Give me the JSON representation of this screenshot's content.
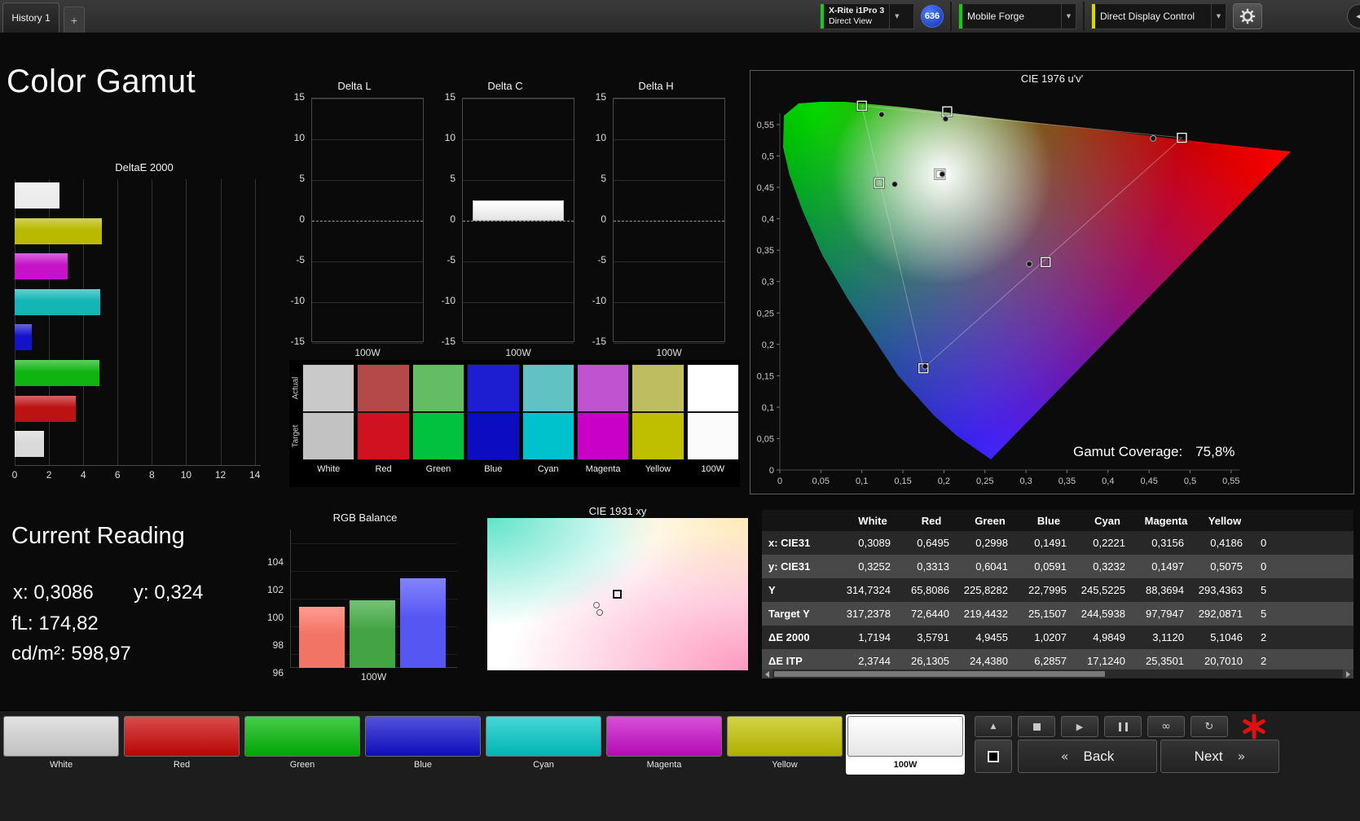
{
  "top_bar": {
    "history_tab": "History 1",
    "add_tab": "+",
    "meter": {
      "line1": "X-Rite i1Pro 3",
      "line2": "Direct View",
      "badge": "636"
    },
    "source": "Mobile Forge",
    "display_control": "Direct Display Control"
  },
  "page_title": "Color Gamut",
  "current_reading": {
    "title": "Current Reading",
    "x_label": "x:",
    "x_value": "0,3086",
    "y_label": "y:",
    "y_value": "0,324",
    "fl_label": "fL:",
    "fl_value": "174,82",
    "cd_label": "cd/m²:",
    "cd_value": "598,97"
  },
  "gamut_coverage": {
    "label": "Gamut Coverage:",
    "value": "75,8%"
  },
  "swatch_strip": {
    "row_labels": [
      "Actual",
      "Target"
    ],
    "columns": [
      {
        "label": "White",
        "actual": "#c9c9c9",
        "target": "#c2c2c2"
      },
      {
        "label": "Red",
        "actual": "#b54848",
        "target": "#d01120"
      },
      {
        "label": "Green",
        "actual": "#64bd64",
        "target": "#00c23e"
      },
      {
        "label": "Blue",
        "actual": "#1d1dd2",
        "target": "#0c0cc2"
      },
      {
        "label": "Cyan",
        "actual": "#60c2c2",
        "target": "#00c2cc"
      },
      {
        "label": "Magenta",
        "actual": "#c053cf",
        "target": "#c800c8"
      },
      {
        "label": "Yellow",
        "actual": "#bebe60",
        "target": "#bfbf00"
      },
      {
        "label": "100W",
        "actual": "#ffffff",
        "target": "#fbfbfb"
      }
    ]
  },
  "table": {
    "columns": [
      "",
      "White",
      "Red",
      "Green",
      "Blue",
      "Cyan",
      "Magenta",
      "Yellow"
    ],
    "rows": [
      {
        "label": "x: CIE31",
        "values": [
          "0,3089",
          "0,6495",
          "0,2998",
          "0,1491",
          "0,2221",
          "0,3156",
          "0,4186"
        ],
        "clipped": "0"
      },
      {
        "label": "y: CIE31",
        "values": [
          "0,3252",
          "0,3313",
          "0,6041",
          "0,0591",
          "0,3232",
          "0,1497",
          "0,5075"
        ],
        "clipped": "0"
      },
      {
        "label": "Y",
        "values": [
          "314,7324",
          "65,8086",
          "225,8282",
          "22,7995",
          "245,5225",
          "88,3694",
          "293,4363"
        ],
        "clipped": "5"
      },
      {
        "label": "Target Y",
        "values": [
          "317,2378",
          "72,6440",
          "219,4432",
          "25,1507",
          "244,5938",
          "97,7947",
          "292,0871"
        ],
        "clipped": "5"
      },
      {
        "label": "ΔE 2000",
        "values": [
          "1,7194",
          "3,5791",
          "4,9455",
          "1,0207",
          "4,9849",
          "3,1120",
          "5,1046"
        ],
        "clipped": "2"
      },
      {
        "label": "ΔE ITP",
        "values": [
          "2,3744",
          "26,1305",
          "24,4380",
          "6,2857",
          "17,1240",
          "25,3501",
          "20,7010"
        ],
        "clipped": "2"
      }
    ]
  },
  "chart_data": [
    {
      "id": "deltae2000",
      "type": "bar",
      "orientation": "horizontal",
      "title": "DeltaE 2000",
      "categories": [
        "100W",
        "Yellow",
        "Magenta",
        "Cyan",
        "Blue",
        "Green",
        "Red",
        "White"
      ],
      "values": [
        2.6,
        5.1,
        3.11,
        4.98,
        1.02,
        4.95,
        3.58,
        1.72
      ],
      "bar_colors": [
        "#ececec",
        "#b9b900",
        "#c713c7",
        "#13b5b5",
        "#1313cc",
        "#10b410",
        "#bc1212",
        "#d9d9d9"
      ],
      "xticks": [
        0,
        2,
        4,
        6,
        8,
        10,
        12,
        14
      ],
      "xlim": [
        0,
        14.35
      ],
      "grid": "vertical"
    },
    {
      "id": "delta_l",
      "type": "bar",
      "title": "Delta L",
      "categories": [
        "100W"
      ],
      "values": [
        0
      ],
      "yticks": [
        15,
        10,
        5,
        0,
        -5,
        -10,
        -15
      ],
      "ylim": [
        -15,
        15
      ],
      "xlabel": "100W"
    },
    {
      "id": "delta_c",
      "type": "bar",
      "title": "Delta C",
      "categories": [
        "100W"
      ],
      "values": [
        2.5
      ],
      "yticks": [
        15,
        10,
        5,
        0,
        -5,
        -10,
        -15
      ],
      "ylim": [
        -15,
        15
      ],
      "xlabel": "100W"
    },
    {
      "id": "delta_h",
      "type": "bar",
      "title": "Delta H",
      "categories": [
        "100W"
      ],
      "values": [
        0
      ],
      "yticks": [
        15,
        10,
        5,
        0,
        -5,
        -10,
        -15
      ],
      "ylim": [
        -15,
        15
      ],
      "xlabel": "100W"
    },
    {
      "id": "cie1976",
      "type": "scatter",
      "title": "CIE 1976 u'v'",
      "xlim": [
        0,
        0.62
      ],
      "ylim": [
        0,
        0.6
      ],
      "xticks": [
        "0",
        "0,05",
        "0,1",
        "0,15",
        "0,2",
        "0,25",
        "0,3",
        "0,35",
        "0,4",
        "0,45",
        "0,5",
        "0,55"
      ],
      "yticks": [
        "0",
        "0,05",
        "0,1",
        "0,15",
        "0,2",
        "0,25",
        "0,3",
        "0,35",
        "0,4",
        "0,45",
        "0,5",
        "0,55"
      ],
      "gamut_triangle_uv": [
        [
          0.1,
          0.58
        ],
        [
          0.49,
          0.529
        ],
        [
          0.175,
          0.162
        ]
      ],
      "targets_uv": [
        [
          0.1,
          0.58
        ],
        [
          0.204,
          0.571
        ],
        [
          0.49,
          0.529
        ],
        [
          0.121,
          0.457
        ],
        [
          0.195,
          0.471
        ],
        [
          0.324,
          0.331
        ],
        [
          0.175,
          0.162
        ]
      ],
      "measured_uv": [
        [
          0.124,
          0.566
        ],
        [
          0.202,
          0.559
        ],
        [
          0.455,
          0.528
        ],
        [
          0.14,
          0.455
        ],
        [
          0.198,
          0.471
        ],
        [
          0.304,
          0.328
        ],
        [
          0.177,
          0.165
        ]
      ],
      "coverage": "75,8%"
    },
    {
      "id": "rgb_balance",
      "type": "bar",
      "title": "RGB Balance",
      "categories": [
        "Red",
        "Green",
        "Blue"
      ],
      "values": [
        99.4,
        99.9,
        101.5
      ],
      "bar_colors": [
        "#ff7a6a",
        "#46ad46",
        "#5a5aff"
      ],
      "yticks": [
        104,
        102,
        100,
        98,
        96
      ],
      "ylim": [
        95,
        105
      ],
      "xlabel": "100W"
    },
    {
      "id": "cie1931",
      "type": "scatter",
      "title": "CIE 1931 xy",
      "target_rel": [
        0.5,
        0.5
      ],
      "measured_rel": [
        [
          0.42,
          0.57
        ],
        [
          0.43,
          0.62
        ]
      ]
    }
  ],
  "bottom_bar": {
    "patches": [
      {
        "label": "White",
        "color": "#d6d6d6"
      },
      {
        "label": "Red",
        "color": "#cc0606"
      },
      {
        "label": "Green",
        "color": "#00b806"
      },
      {
        "label": "Blue",
        "color": "#0f0fd0"
      },
      {
        "label": "Cyan",
        "color": "#00c8c8"
      },
      {
        "label": "Magenta",
        "color": "#c80cc8"
      },
      {
        "label": "Yellow",
        "color": "#c2c200"
      },
      {
        "label": "100W",
        "color": "#ffffff",
        "selected": true
      }
    ],
    "back": "Back",
    "next": "Next",
    "back_chevron": "«",
    "next_chevron": "»"
  }
}
